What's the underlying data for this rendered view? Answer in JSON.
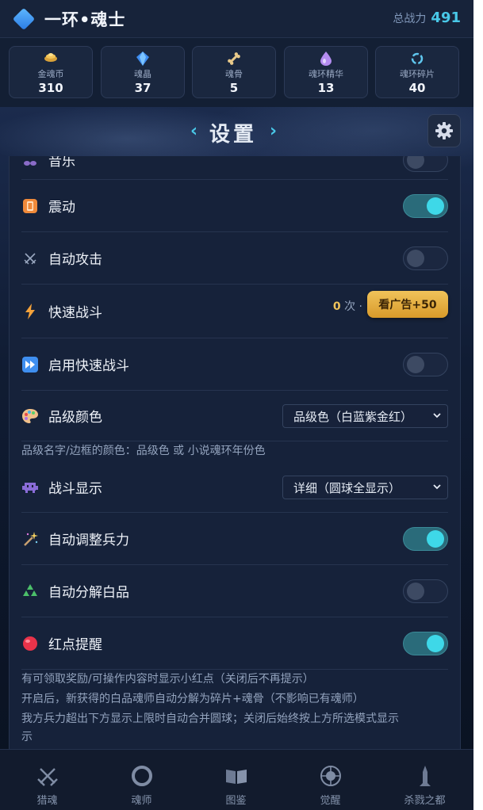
{
  "header": {
    "title": "一环•魂士",
    "power_label": "总战力",
    "power_value": "491"
  },
  "resources": [
    {
      "icon": "gold-coin-icon",
      "name": "金魂币",
      "value": "310"
    },
    {
      "icon": "soul-crystal-icon",
      "name": "魂晶",
      "value": "37"
    },
    {
      "icon": "soul-bone-icon",
      "name": "魂骨",
      "value": "5"
    },
    {
      "icon": "essence-drop-icon",
      "name": "魂环精华",
      "value": "13"
    },
    {
      "icon": "ring-fragment-icon",
      "name": "魂环碎片",
      "value": "40"
    }
  ],
  "settings_title": {
    "left_arrow": "‹",
    "text": "设置",
    "right_arrow": "›"
  },
  "settings": {
    "music_label": "音乐",
    "vibration_label": "震动",
    "auto_attack_label": "自动攻击",
    "fast_battle_label": "快速战斗",
    "fast_battle_count": "0",
    "fast_battle_count_suffix": "次 ·",
    "ad_button_label": "看广告+50",
    "enable_fast_battle_label": "启用快速战斗",
    "grade_color_label": "品级颜色",
    "grade_color_value": "品级色（白蓝紫金红）",
    "grade_color_note": "品级名字/边框的颜色：品级色 或 小说魂环年份色",
    "battle_display_label": "战斗显示",
    "battle_display_value": "详细（圆球全显示）",
    "auto_adjust_label": "自动调整兵力",
    "auto_decompose_label": "自动分解白品",
    "red_dot_label": "红点提醒",
    "notes": [
      "有可领取奖励/可操作内容时显示小红点（关闭后不再提示）",
      "开启后，新获得的白品魂师自动分解为碎片+魂骨（不影响已有魂师）",
      "我方兵力超出下方显示上限时自动合并圆球；关闭后始终按上方所选模式显示",
      "示"
    ]
  },
  "toggles": {
    "music": false,
    "vibration": true,
    "auto_attack": false,
    "enable_fast_battle": false,
    "auto_adjust": true,
    "auto_decompose": false,
    "red_dot": true
  },
  "bottom_nav": [
    {
      "icon": "crossed-swords-icon",
      "label": "猎魂"
    },
    {
      "icon": "ring-icon",
      "label": "魂师"
    },
    {
      "icon": "book-icon",
      "label": "图鉴"
    },
    {
      "icon": "awaken-orb-icon",
      "label": "觉醒"
    },
    {
      "icon": "tower-icon",
      "label": "杀戮之都"
    }
  ],
  "colors": {
    "accent": "#49c8e8",
    "toggle_on": "#3ed8e8",
    "ad_button": "#e3ac40",
    "panel": "#16223a"
  }
}
